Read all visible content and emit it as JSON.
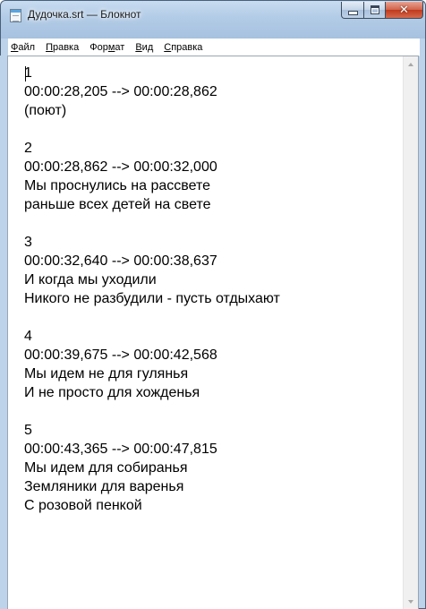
{
  "window": {
    "title": "Дудочка.srt — Блокнот",
    "icon": "notepad-icon",
    "controls": {
      "minimize": "minimize-icon",
      "maximize": "maximize-icon",
      "close": "close-icon",
      "close_glyph": "✕"
    }
  },
  "menu": {
    "items": [
      {
        "label": "Файл",
        "accel": "Ф"
      },
      {
        "label": "Правка",
        "accel": "П"
      },
      {
        "label": "Формат",
        "accel": "м"
      },
      {
        "label": "Вид",
        "accel": "В"
      },
      {
        "label": "Справка",
        "accel": "С"
      }
    ]
  },
  "document": {
    "lines": [
      "1",
      "00:00:28,205 --> 00:00:28,862",
      "(поют)",
      "",
      "2",
      "00:00:28,862 --> 00:00:32,000",
      "Мы проснулись на рассвете",
      "раньше всех детей на свете",
      "",
      "3",
      "00:00:32,640 --> 00:00:38,637",
      "И когда мы уходили",
      "Никого не разбудили - пусть отдыхают",
      "",
      "4",
      "00:00:39,675 --> 00:00:42,568",
      "Мы идем не для гулянья",
      "И не просто для хожденья",
      "",
      "5",
      "00:00:43,365 --> 00:00:47,815",
      "Мы идем для собиранья",
      "Земляники для варенья",
      "С розовой пенкой"
    ]
  },
  "colors": {
    "frame": "#bcd3ea",
    "close_button": "#c0391c",
    "text": "#000000"
  }
}
